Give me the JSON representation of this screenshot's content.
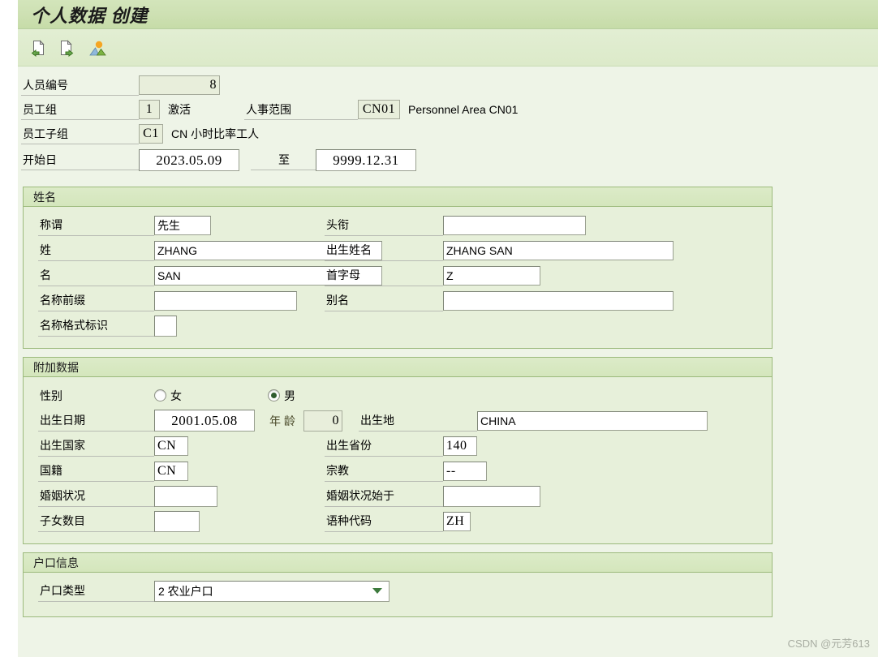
{
  "window": {
    "title": "个人数据 创建"
  },
  "toolbar": {
    "buttons": [
      {
        "name": "previous-record-icon",
        "tooltip": "上一条"
      },
      {
        "name": "next-record-icon",
        "tooltip": "下一条"
      },
      {
        "name": "picture-icon",
        "tooltip": "图片"
      }
    ]
  },
  "header": {
    "rows": [
      {
        "label": "人员编号",
        "value": "8"
      },
      {
        "label": "员工组",
        "value": "1",
        "text": "激活"
      },
      {
        "label": "员工子组",
        "value": "C1",
        "text": "CN 小时比率工人"
      }
    ],
    "personnel_area": {
      "label": "人事范围",
      "value": "CN01",
      "text": "Personnel Area CN01"
    },
    "validity": {
      "label": "开始日",
      "from": "2023.05.09",
      "to_label": "至",
      "to": "9999.12.31"
    }
  },
  "sections": {
    "name": {
      "title": "姓名",
      "left": [
        {
          "label": "称谓",
          "value": "先生"
        },
        {
          "label": "姓",
          "value": "ZHANG"
        },
        {
          "label": "名",
          "value": "SAN"
        },
        {
          "label": "名称前缀",
          "value": ""
        },
        {
          "label": "名称格式标识",
          "value": ""
        }
      ],
      "right": [
        {
          "label": "头衔",
          "value": ""
        },
        {
          "label": "出生姓名",
          "value": "ZHANG SAN"
        },
        {
          "label": "首字母",
          "value": "Z"
        },
        {
          "label": "别名",
          "value": ""
        }
      ]
    },
    "additional": {
      "title": "附加数据",
      "gender": {
        "label": "性别",
        "options": [
          {
            "label": "女",
            "selected": false
          },
          {
            "label": "男",
            "selected": true
          }
        ]
      },
      "birthdate": {
        "label": "出生日期",
        "value": "2001.05.08"
      },
      "age": {
        "label": "年 龄",
        "value": "0"
      },
      "left": [
        {
          "label": "出生国家",
          "value": "CN"
        },
        {
          "label": "国籍",
          "value": "CN"
        },
        {
          "label": "婚姻状况",
          "value": ""
        },
        {
          "label": "子女数目",
          "value": ""
        }
      ],
      "right": [
        {
          "label": "出生地",
          "value": "CHINA"
        },
        {
          "label": "出生省份",
          "value": "140"
        },
        {
          "label": "宗教",
          "value": "--"
        },
        {
          "label": "婚姻状况始于",
          "value": ""
        },
        {
          "label": "语种代码",
          "value": "ZH"
        }
      ]
    },
    "household": {
      "title": "户口信息",
      "type": {
        "label": "户口类型",
        "value": "2 农业户口"
      }
    }
  },
  "watermark": "CSDN @元芳613"
}
